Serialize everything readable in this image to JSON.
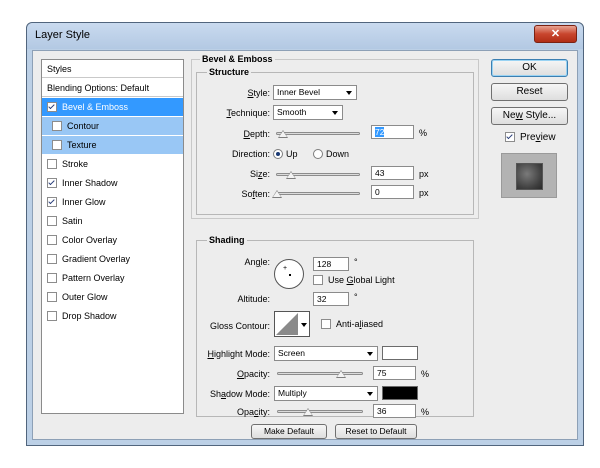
{
  "window": {
    "title": "Layer Style",
    "close_glyph": "✕"
  },
  "styles_list": {
    "header": "Styles",
    "blending": "Blending Options: Default",
    "items": [
      {
        "label": "Bevel & Emboss",
        "checked": true
      },
      {
        "label": "Contour",
        "checked": false
      },
      {
        "label": "Texture",
        "checked": false
      },
      {
        "label": "Stroke",
        "checked": false
      },
      {
        "label": "Inner Shadow",
        "checked": true
      },
      {
        "label": "Inner Glow",
        "checked": true
      },
      {
        "label": "Satin",
        "checked": false
      },
      {
        "label": "Color Overlay",
        "checked": false
      },
      {
        "label": "Gradient Overlay",
        "checked": false
      },
      {
        "label": "Pattern Overlay",
        "checked": false
      },
      {
        "label": "Outer Glow",
        "checked": false
      },
      {
        "label": "Drop Shadow",
        "checked": false
      }
    ]
  },
  "bevel": {
    "group_title": "Bevel & Emboss",
    "structure_title": "Structure",
    "style_label_pre": "",
    "style_label_u": "S",
    "style_label_post": "tyle:",
    "style_value": "Inner Bevel",
    "technique_label_pre": "",
    "technique_label_u": "T",
    "technique_label_post": "echnique:",
    "technique_value": "Smooth",
    "depth_label_pre": "",
    "depth_label_u": "D",
    "depth_label_post": "epth:",
    "depth_value": "72",
    "depth_fraction": 0.072,
    "percent": "%",
    "direction_label": "Direction:",
    "direction_up": "Up",
    "direction_down": "Down",
    "direction_selected": "Up",
    "size_label_pre": "Si",
    "size_label_u": "z",
    "size_label_post": "e:",
    "size_value": "43",
    "size_fraction": 0.172,
    "px": "px",
    "soften_label_pre": "So",
    "soften_label_u": "f",
    "soften_label_post": "ten:",
    "soften_value": "0",
    "soften_fraction": 0.0
  },
  "shading": {
    "title": "Shading",
    "angle_label_pre": "An",
    "angle_label_u": "g",
    "angle_label_post": "le:",
    "angle_value": "128",
    "degree": "°",
    "use_global_light_pre": "Use ",
    "use_global_light_u": "G",
    "use_global_light_post": "lobal Light",
    "use_global_light_checked": false,
    "altitude_label": "Altitude:",
    "altitude_value": "32",
    "gloss_contour_label": "Gloss Contour:",
    "anti_aliased_pre": "Anti-a",
    "anti_aliased_u": "l",
    "anti_aliased_post": "iased",
    "anti_aliased_checked": false,
    "highlight_mode_label_pre": "",
    "highlight_mode_label_u": "H",
    "highlight_mode_label_post": "ighlight Mode:",
    "highlight_mode_value": "Screen",
    "highlight_color": "#ffffff",
    "highlight_opacity_label_pre": "",
    "highlight_opacity_label_u": "O",
    "highlight_opacity_label_post": "pacity:",
    "highlight_opacity_value": "75",
    "highlight_opacity_fraction": 0.75,
    "shadow_mode_label_pre": "Sh",
    "shadow_mode_label_u": "a",
    "shadow_mode_label_post": "dow Mode:",
    "shadow_mode_value": "Multiply",
    "shadow_color": "#000000",
    "shadow_opacity_label_pre": "Opa",
    "shadow_opacity_label_u": "c",
    "shadow_opacity_label_post": "ity:",
    "shadow_opacity_value": "36",
    "shadow_opacity_fraction": 0.36,
    "percent": "%"
  },
  "bottom_buttons": {
    "make_default": "Make Default",
    "reset_to_default": "Reset to Default"
  },
  "right_panel": {
    "ok": "OK",
    "reset": "Reset",
    "new_style_pre": "Ne",
    "new_style_u": "w",
    "new_style_post": " Style...",
    "preview_pre": "Pre",
    "preview_u": "v",
    "preview_post": "iew",
    "preview_checked": true
  },
  "colors": {
    "selected_row": "#3399ff",
    "sub_row": "#99c7f5",
    "selection_highlight": "#3399ff"
  }
}
